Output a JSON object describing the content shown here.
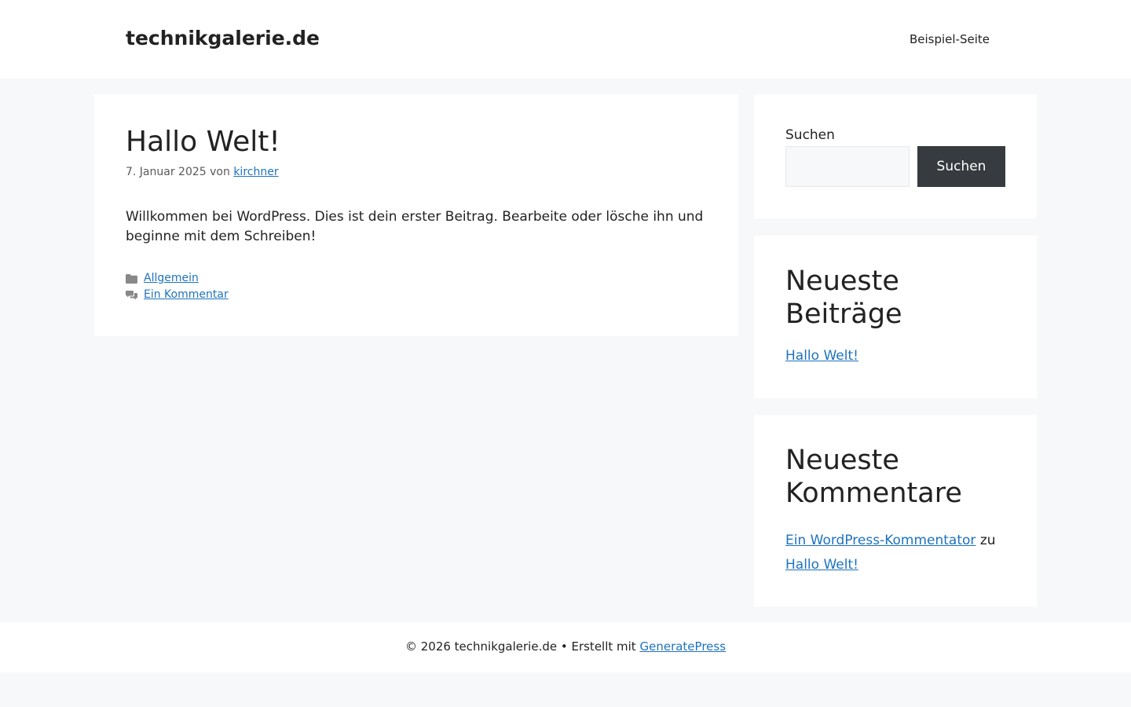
{
  "header": {
    "site_title": "technikgalerie.de",
    "nav": [
      {
        "label": "Beispiel-Seite"
      }
    ]
  },
  "post": {
    "title": "Hallo Welt!",
    "date": "7. Januar 2025",
    "by_text": "von",
    "author": "kirchner",
    "content": "Willkommen bei WordPress. Dies ist dein erster Beitrag. Bearbeite oder lösche ihn und beginne mit dem Schreiben!",
    "category": "Allgemein",
    "comments_link": "Ein Kommentar",
    "category_icon": "folder-icon",
    "comments_icon": "comments-icon"
  },
  "sidebar": {
    "search": {
      "label": "Suchen",
      "value": "",
      "placeholder": "",
      "button_label": "Suchen"
    },
    "recent_posts": {
      "title": "Neueste Beiträge",
      "items": [
        {
          "label": "Hallo Welt!"
        }
      ]
    },
    "recent_comments": {
      "title": "Neueste Kommentare",
      "items": [
        {
          "author": "Ein WordPress-Kommentator",
          "connector": "zu",
          "post": "Hallo Welt!"
        }
      ]
    }
  },
  "footer": {
    "copyright": "© 2026 technikgalerie.de • Erstellt mit",
    "theme_link": "GeneratePress"
  },
  "colors": {
    "background": "#f7f8f9",
    "surface": "#ffffff",
    "text": "#222222",
    "link": "#1e73be",
    "button": "#373b3f",
    "meta": "#595959"
  }
}
